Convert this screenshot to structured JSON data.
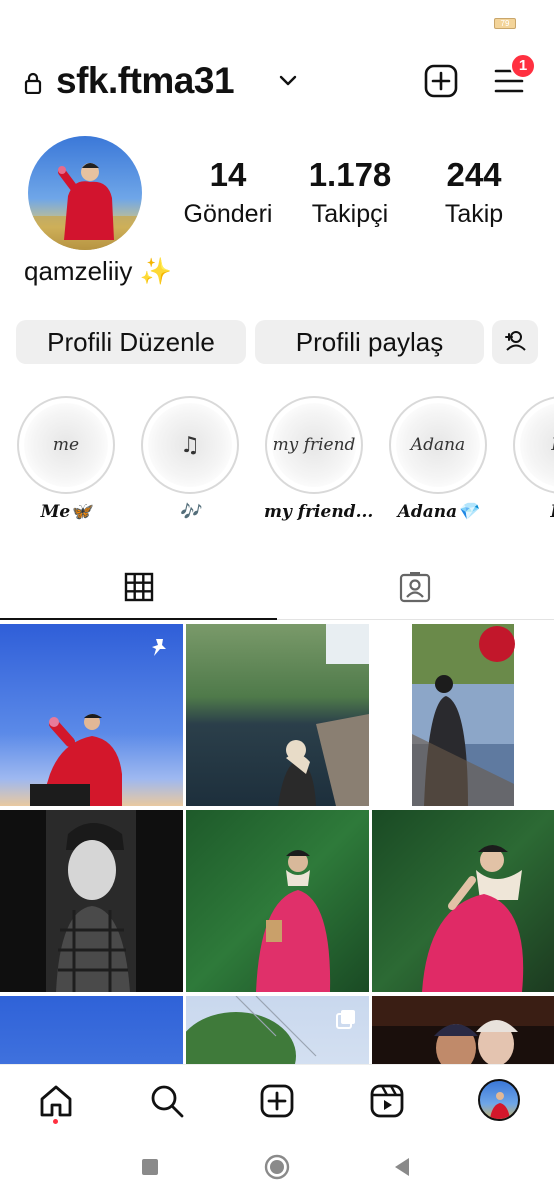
{
  "status": {
    "battery": "79"
  },
  "header": {
    "username": "sfk.ftma31",
    "notification_count": "1"
  },
  "profile": {
    "display_name": "qamzeliiy ✨",
    "stats": [
      {
        "value": "14",
        "label": "Gönderi"
      },
      {
        "value": "1.178",
        "label": "Takipçi"
      },
      {
        "value": "244",
        "label": "Takip"
      }
    ]
  },
  "actions": {
    "edit_profile": "Profili Düzenle",
    "share_profile": "Profili paylaş"
  },
  "highlights": [
    {
      "label": "Me🦋",
      "cover_text": "me"
    },
    {
      "label": "🎶",
      "cover_text": "♫"
    },
    {
      "label": "my friend...",
      "cover_text": "my friend"
    },
    {
      "label": "Adana💎",
      "cover_text": "Adana"
    },
    {
      "label": "Lo",
      "cover_text": "Lo"
    }
  ],
  "colors": {
    "accent_red": "#ff3040",
    "button_bg": "#efefef"
  }
}
